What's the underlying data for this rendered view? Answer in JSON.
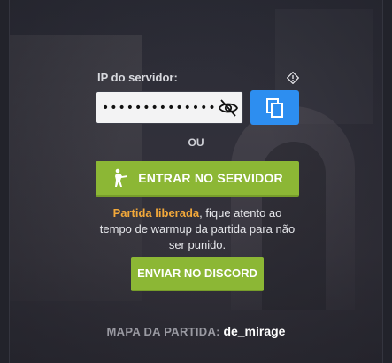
{
  "server": {
    "ip_label": "IP do servidor:",
    "ip_masked_value": "••••••••••••••",
    "or_label": "OU",
    "enter_button_label": "ENTRAR NO SERVIDOR"
  },
  "notice": {
    "highlight": "Partida liberada",
    "text": ", fique atento ao tempo de warmup da partida para não ser punido."
  },
  "discord": {
    "button_label": "ENVIAR NO DISCORD"
  },
  "map": {
    "label": "MAPA DA PARTIDA:",
    "value": "de_mirage"
  },
  "colors": {
    "accent_green": "#8cb735",
    "copy_blue": "#2d8ef0",
    "highlight_orange": "#f2a83a",
    "panel_bg": "#22232b"
  },
  "icons": {
    "info": "info-diamond-icon",
    "eye": "eye-slash-icon",
    "copy": "copy-icon",
    "soldier": "soldier-icon"
  }
}
